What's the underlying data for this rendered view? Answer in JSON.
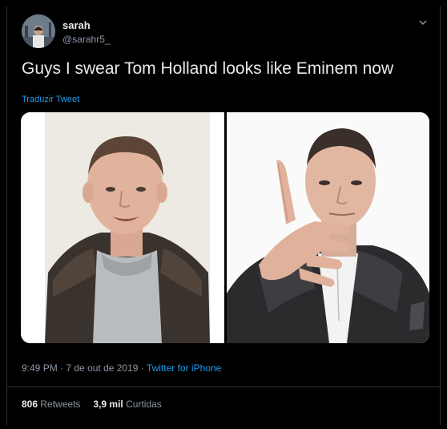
{
  "user": {
    "name": "sarah",
    "handle": "@sarahr5_"
  },
  "tweet": {
    "text": "Guys I swear Tom Holland looks like Eminem now",
    "translate_label": "Traduzir Tweet"
  },
  "meta": {
    "time": "9:49 PM",
    "separator1": " · ",
    "date": "7 de out de 2019",
    "separator2": " · ",
    "app": "Twitter for iPhone"
  },
  "stats": {
    "retweets_count": "806",
    "retweets_label": "Retweets",
    "likes_count": "3,9 mil",
    "likes_label": "Curtidas"
  },
  "icons": {
    "menu": "chevron-down-icon"
  },
  "media": {
    "left_photo": "photo of young man with short hair in dark jacket",
    "right_photo": "photo of man in leather jacket pointing hand toward camera"
  }
}
